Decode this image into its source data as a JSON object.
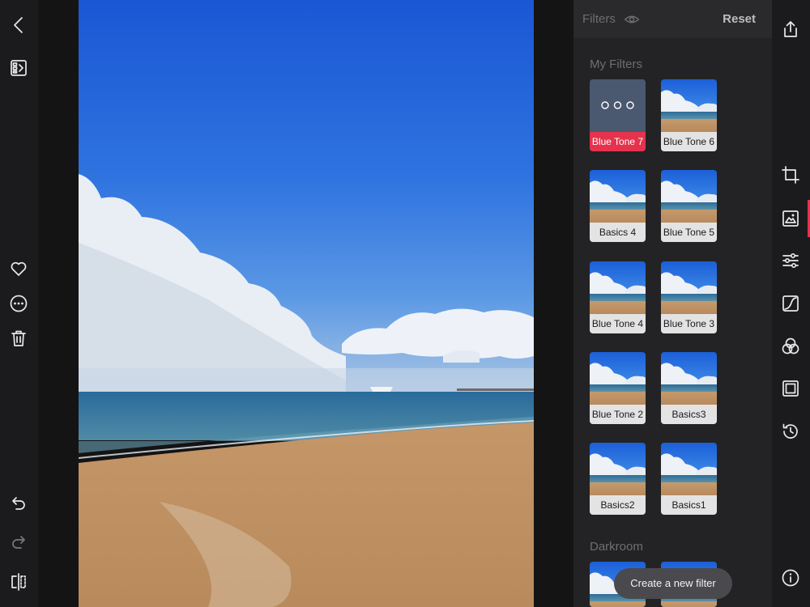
{
  "panel": {
    "title": "Filters",
    "reset_label": "Reset",
    "my_filters_label": "My Filters",
    "darkroom_label": "Darkroom",
    "filters": [
      {
        "label": "Blue Tone 7",
        "active": true
      },
      {
        "label": "Blue Tone 6",
        "active": false
      },
      {
        "label": "Basics 4",
        "active": false
      },
      {
        "label": "Blue Tone 5",
        "active": false
      },
      {
        "label": "Blue Tone 4",
        "active": false
      },
      {
        "label": "Blue Tone 3",
        "active": false
      },
      {
        "label": "Blue Tone 2",
        "active": false
      },
      {
        "label": "Basics3",
        "active": false
      },
      {
        "label": "Basics2",
        "active": false
      },
      {
        "label": "Basics1",
        "active": false
      }
    ]
  },
  "create_filter_label": "Create a new filter",
  "left_toolbar": [
    "back-icon",
    "image-list-icon",
    "heart-icon",
    "more-icon",
    "trash-icon",
    "undo-icon",
    "redo-icon",
    "compare-icon"
  ],
  "right_toolbar": [
    "share-icon",
    "crop-icon",
    "filters-icon",
    "adjust-icon",
    "curves-icon",
    "color-icon",
    "frame-icon",
    "history-icon",
    "info-icon"
  ],
  "colors": {
    "accent": "#e5334e",
    "panel_bg": "#232325",
    "toolbar_bg": "#1b1b1d"
  }
}
